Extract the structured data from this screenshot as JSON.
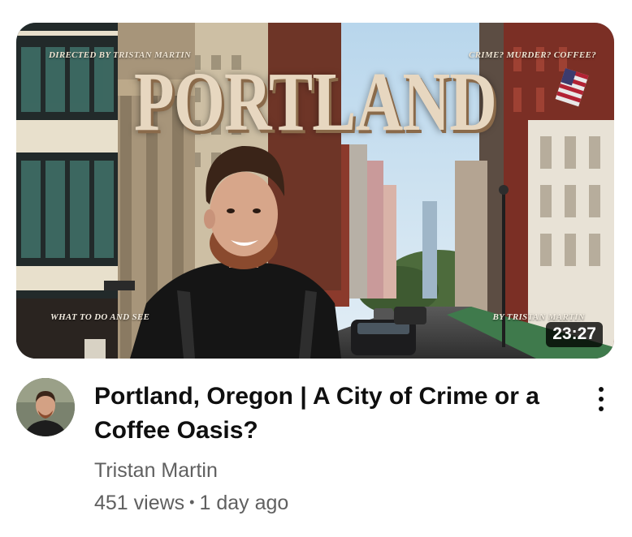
{
  "thumbnail": {
    "big_title": "PORTLAND",
    "director_credit": "DIRECTED BY TRISTAN MARTIN",
    "tagline": "CRIME? MURDER? COFFEE?",
    "bottom_left_text": "WHAT TO DO AND SEE",
    "bottom_right_text": "BY TRISTAN MARTIN",
    "duration": "23:27"
  },
  "video": {
    "title": "Portland, Oregon | A City of Crime or a Coffee Oasis?",
    "channel": "Tristan Martin",
    "views": "451 views",
    "separator": "•",
    "age": "1 day ago"
  },
  "icons": {
    "menu": "more-vert-icon",
    "avatar": "channel-avatar"
  }
}
